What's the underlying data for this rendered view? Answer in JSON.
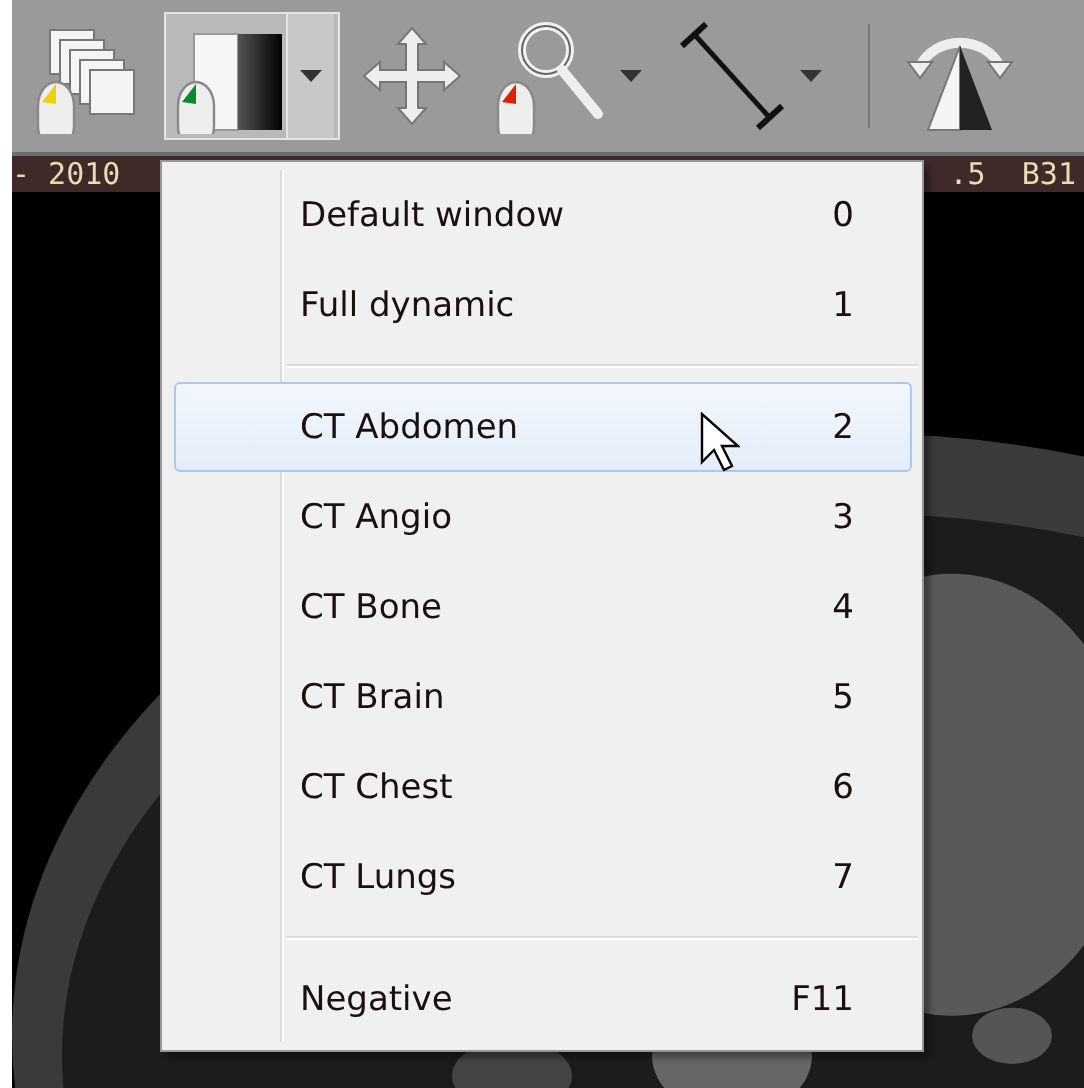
{
  "toolbar": {
    "tools": [
      {
        "kind": "stack",
        "pressed": false,
        "dropdown": false
      },
      {
        "kind": "window",
        "pressed": true,
        "dropdown": true
      },
      {
        "kind": "move",
        "pressed": false,
        "dropdown": false
      },
      {
        "kind": "zoom",
        "pressed": false,
        "dropdown": true
      },
      {
        "kind": "measure",
        "pressed": false,
        "dropdown": true
      },
      {
        "kind": "separator"
      },
      {
        "kind": "rotate",
        "pressed": false,
        "dropdown": false
      }
    ]
  },
  "info_bar": {
    "left": "- 2010",
    "right": ".5  B31"
  },
  "menu": {
    "sections": [
      [
        {
          "label": "Default window",
          "shortcut": "0",
          "selected": false
        },
        {
          "label": "Full dynamic",
          "shortcut": "1",
          "selected": false
        }
      ],
      [
        {
          "label": "CT Abdomen",
          "shortcut": "2",
          "selected": true
        },
        {
          "label": "CT Angio",
          "shortcut": "3",
          "selected": false
        },
        {
          "label": "CT Bone",
          "shortcut": "4",
          "selected": false
        },
        {
          "label": "CT Brain",
          "shortcut": "5",
          "selected": false
        },
        {
          "label": "CT Chest",
          "shortcut": "6",
          "selected": false
        },
        {
          "label": "CT Lungs",
          "shortcut": "7",
          "selected": false
        }
      ],
      [
        {
          "label": "Negative",
          "shortcut": "F11",
          "selected": false
        }
      ]
    ]
  }
}
